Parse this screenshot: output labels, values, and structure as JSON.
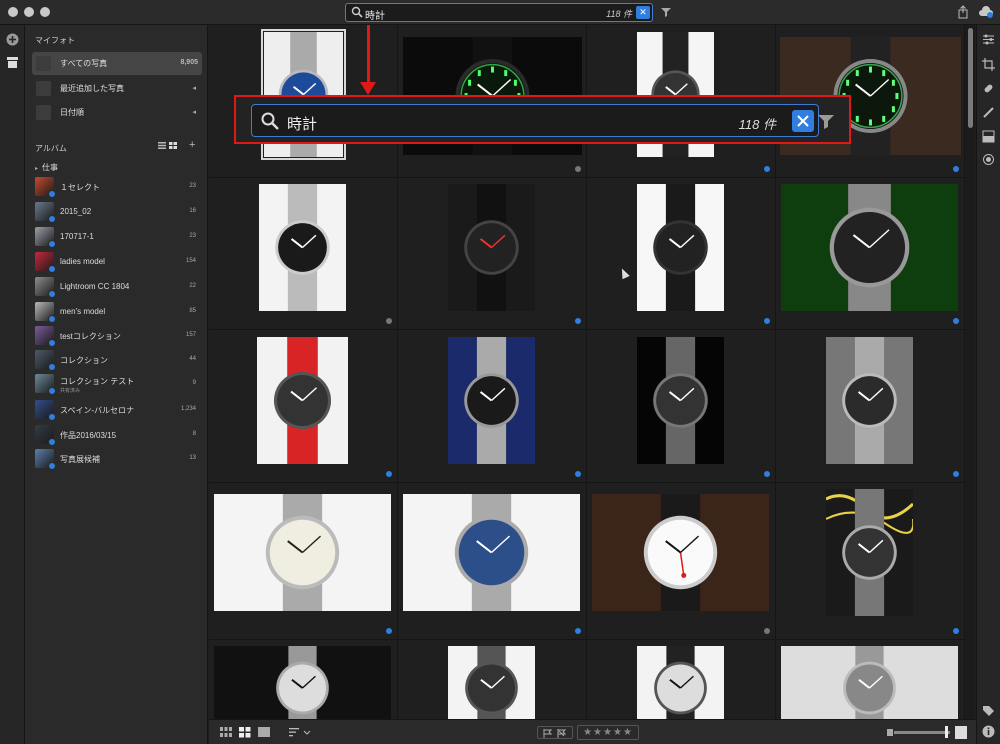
{
  "app": {
    "search_query": "時計",
    "result_count": "118 件",
    "clear_icon": "close-icon",
    "filter_icon": "filter-icon"
  },
  "sidebar": {
    "my_photos_header": "マイフォト",
    "items": [
      {
        "label": "すべての写真",
        "count": "8,905",
        "icon": "photos-icon",
        "selected": true
      },
      {
        "label": "最近追加した写真",
        "icon": "recent-icon"
      },
      {
        "label": "日付順",
        "icon": "calendar-icon"
      }
    ],
    "albums_header": "アルバム",
    "folder": "仕事",
    "albums": [
      {
        "label": "１セレクト",
        "count": "23",
        "color": "#c94a2c"
      },
      {
        "label": "2015_02",
        "count": "16",
        "color": "#6b7a8d"
      },
      {
        "label": "170717-1",
        "count": "23",
        "color": "#9aa0a8"
      },
      {
        "label": "ladies model",
        "count": "154",
        "color": "#c8283a"
      },
      {
        "label": "Lightroom CC 1804",
        "count": "22",
        "color": "#8e8e8e"
      },
      {
        "label": "men's model",
        "count": "85",
        "color": "#b9b9b9"
      },
      {
        "label": "testコレクション",
        "count": "157",
        "color": "#7a5c9a"
      },
      {
        "label": "コレクション",
        "count": "44",
        "color": "#4e5a68"
      },
      {
        "label": "コレクション テスト",
        "sub": "共有済み",
        "count": "9",
        "color": "#6d8a99"
      },
      {
        "label": "スペイン-バルセロナ",
        "count": "1,234",
        "color": "#324e8a"
      },
      {
        "label": "作品2016/03/15",
        "count": "8",
        "color": "#333b44"
      },
      {
        "label": "写真展候補",
        "count": "13",
        "color": "#5b7fb0"
      }
    ]
  },
  "grid": {
    "rows": [
      [
        "silver-blue",
        "green-night",
        "black-mono",
        "green-night-2"
      ],
      [
        "silver-chrono",
        "black-wenger",
        "black-rubber",
        "green-sport"
      ],
      [
        "red-strap",
        "blue-diver",
        "dark-steel",
        "silver-diver"
      ],
      [
        "white-classic",
        "blue-chrono",
        "mondaine",
        "yellow-pair"
      ],
      [
        "silver-multi",
        "gray-digital",
        "white-black",
        "collection"
      ]
    ]
  },
  "bottom": {
    "stars": "★★★★★",
    "view_grid_icon": "grid-view-icon",
    "view_square_icon": "square-view-icon",
    "view_single_icon": "single-view-icon",
    "sort_icon": "sort-icon"
  }
}
